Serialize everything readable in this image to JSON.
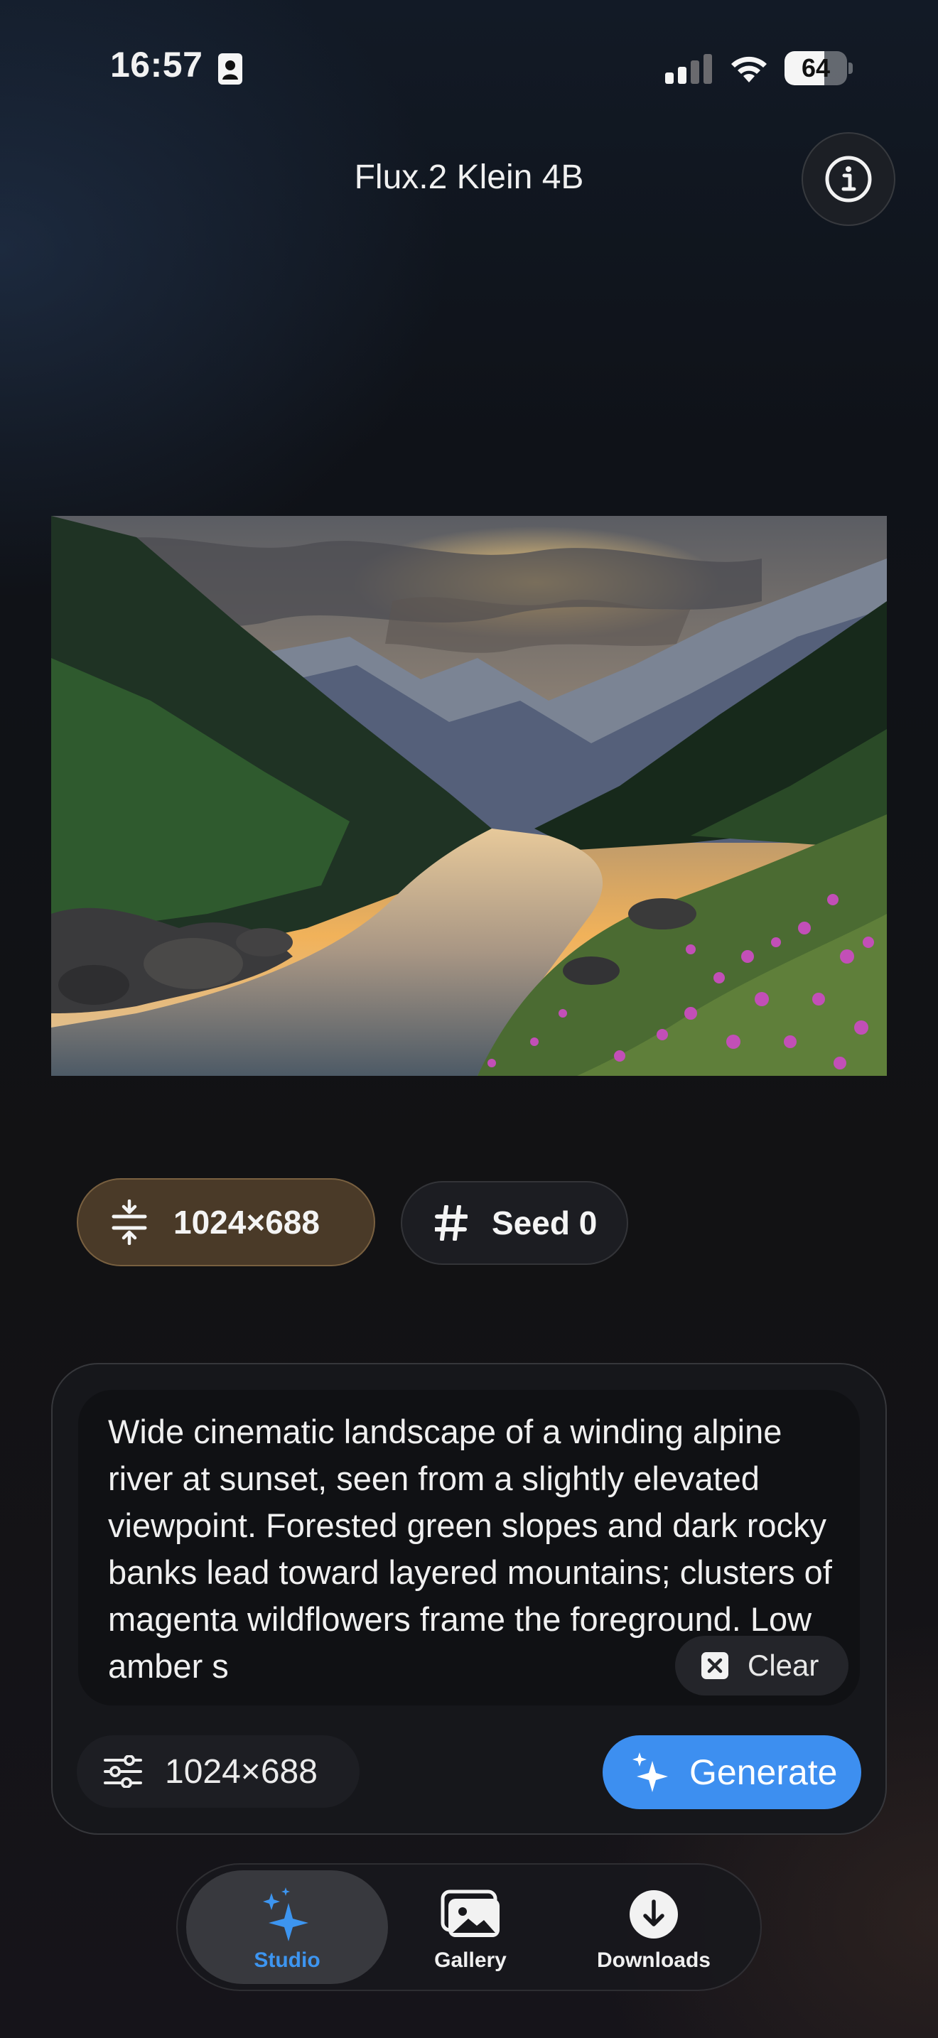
{
  "status_bar": {
    "time": "16:57",
    "battery_level": "64",
    "battery_fraction": 0.64,
    "icons": [
      "person-badge-icon",
      "cellular-signal-icon",
      "wifi-icon",
      "battery-icon"
    ]
  },
  "header": {
    "title": "Flux.2 Klein 4B",
    "info_icon": "info-circle-icon"
  },
  "image": {
    "description_icon": "generated-landscape-image"
  },
  "chips": {
    "size_label": "1024×688",
    "seed_label": "Seed 0"
  },
  "prompt": {
    "text": "Wide cinematic landscape of a winding alpine river at sunset, seen from a slightly elevated viewpoint. Forested green slopes and dark rocky banks lead toward layered mountains; clusters of magenta wildflowers frame the foreground. Low amber s",
    "clear_label": "Clear"
  },
  "controls": {
    "settings_value": "1024×688",
    "generate_label": "Generate"
  },
  "tabs": [
    {
      "label": "Studio",
      "icon": "sparkles-icon",
      "active": true
    },
    {
      "label": "Gallery",
      "icon": "photos-icon",
      "active": false
    },
    {
      "label": "Downloads",
      "icon": "download-circle-icon",
      "active": false
    }
  ],
  "colors": {
    "accent": "#3d8ff0",
    "size_chip": "#4a3a28"
  }
}
